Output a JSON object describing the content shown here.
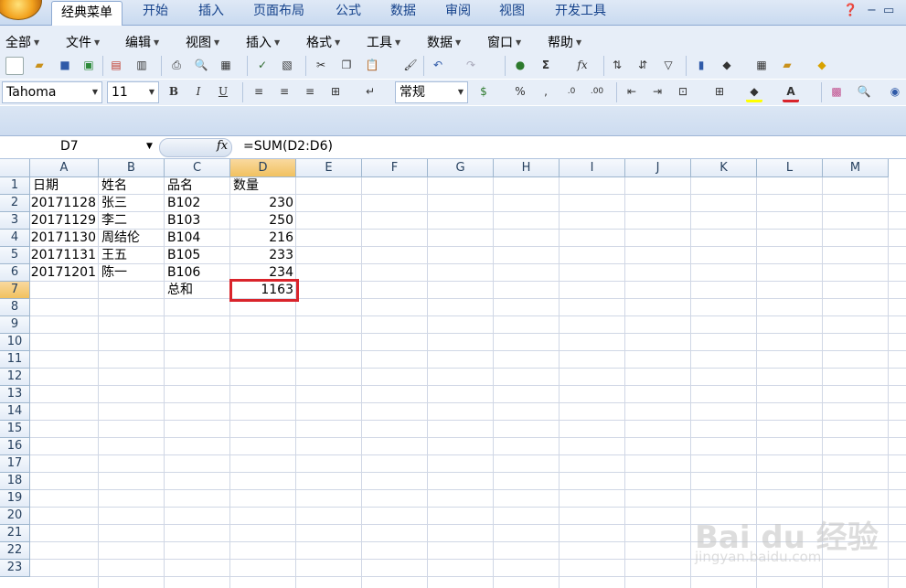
{
  "ribbon_tabs": [
    "经典菜单",
    "开始",
    "插入",
    "页面布局",
    "公式",
    "数据",
    "审阅",
    "视图",
    "开发工具"
  ],
  "menus": [
    "全部",
    "文件",
    "编辑",
    "视图",
    "插入",
    "格式",
    "工具",
    "数据",
    "窗口",
    "帮助"
  ],
  "font": {
    "name": "Tahoma",
    "size": "11",
    "number_format": "常规"
  },
  "formula_bar": {
    "name_box": "D7",
    "fx": "fx",
    "formula": "=SUM(D2:D6)"
  },
  "columns": [
    "A",
    "B",
    "C",
    "D",
    "E",
    "F",
    "G",
    "H",
    "I",
    "J",
    "K",
    "L",
    "M"
  ],
  "rows": [
    "1",
    "2",
    "3",
    "4",
    "5",
    "6",
    "7",
    "8",
    "9",
    "10",
    "11",
    "12",
    "13",
    "14",
    "15",
    "16",
    "17",
    "18",
    "19",
    "20",
    "21",
    "22",
    "23"
  ],
  "cells": {
    "A1": "日期",
    "B1": "姓名",
    "C1": "品名",
    "D1": "数量",
    "A2": "20171128",
    "B2": "张三",
    "C2": "B102",
    "D2": "230",
    "A3": "20171129",
    "B3": "李二",
    "C3": "B103",
    "D3": "250",
    "A4": "20171130",
    "B4": "周结伦",
    "C4": "B104",
    "D4": "216",
    "A5": "20171131",
    "B5": "王五",
    "C5": "B105",
    "D5": "233",
    "A6": "20171201",
    "B6": "陈一",
    "C6": "B106",
    "D6": "234",
    "C7": "总和",
    "D7": "1163"
  },
  "selected_cell": "D7",
  "watermark": {
    "main": "Bai du 经验",
    "sub": "jingyan.baidu.com"
  },
  "colors": {
    "accent": "#d9242b",
    "header_selected": "#f1c15f"
  }
}
